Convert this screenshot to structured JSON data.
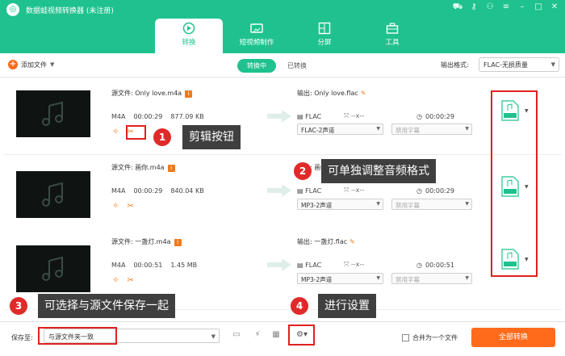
{
  "app": {
    "title": "数据蛙视频转换器 (未注册)",
    "window_controls": [
      "cart-icon",
      "key-icon",
      "user-icon",
      "menu-icon",
      "minimize-icon",
      "maximize-icon",
      "close-icon"
    ]
  },
  "tabs": [
    {
      "label": "转换",
      "active": true
    },
    {
      "label": "短视频制作",
      "active": false
    },
    {
      "label": "分屏",
      "active": false
    },
    {
      "label": "工具",
      "active": false
    }
  ],
  "toolbar": {
    "add_label": "添加文件",
    "switch_on": "转换中",
    "switch_off": "已转换",
    "output_format_label": "输出格式:",
    "output_format_value": "FLAC-无损质量"
  },
  "files": [
    {
      "src": "源文件: Only love.m4a",
      "fmt": "M4A",
      "dur": "00:00:29",
      "size": "877.09 KB",
      "out": "输出: Only love.flac",
      "ofmt": "FLAC",
      "ores": "--x--",
      "odur": "00:00:29",
      "audio": "FLAC-2声道",
      "sub": "禁用字幕"
    },
    {
      "src": "源文件: 画你.m4a",
      "fmt": "M4A",
      "dur": "00:00:29",
      "size": "840.04 KB",
      "out": "输出: 画你.flac",
      "ofmt": "FLAC",
      "ores": "--x--",
      "odur": "00:00:29",
      "audio": "MP3-2声道",
      "sub": "禁用字幕"
    },
    {
      "src": "源文件: 一盏灯.m4a",
      "fmt": "M4A",
      "dur": "00:00:51",
      "size": "1.45 MB",
      "out": "输出: 一盏灯.flac",
      "ofmt": "FLAC",
      "ores": "--x--",
      "odur": "00:00:51",
      "audio": "MP3-2声道",
      "sub": "禁用字幕"
    }
  ],
  "bottom": {
    "save_label": "保存至:",
    "save_value": "与源文件夹一致",
    "merge_label": "合并为一个文件",
    "convert_all": "全部转换"
  },
  "callouts": [
    {
      "num": "1",
      "text": "剪辑按钮"
    },
    {
      "num": "2",
      "text": "可单独调整音频格式"
    },
    {
      "num": "3",
      "text": "可选择与源文件保存一起"
    },
    {
      "num": "4",
      "text": "进行设置"
    }
  ],
  "colors": {
    "brand": "#1fc28e",
    "accent": "#ff6b1a",
    "highlight": "#e02020"
  }
}
